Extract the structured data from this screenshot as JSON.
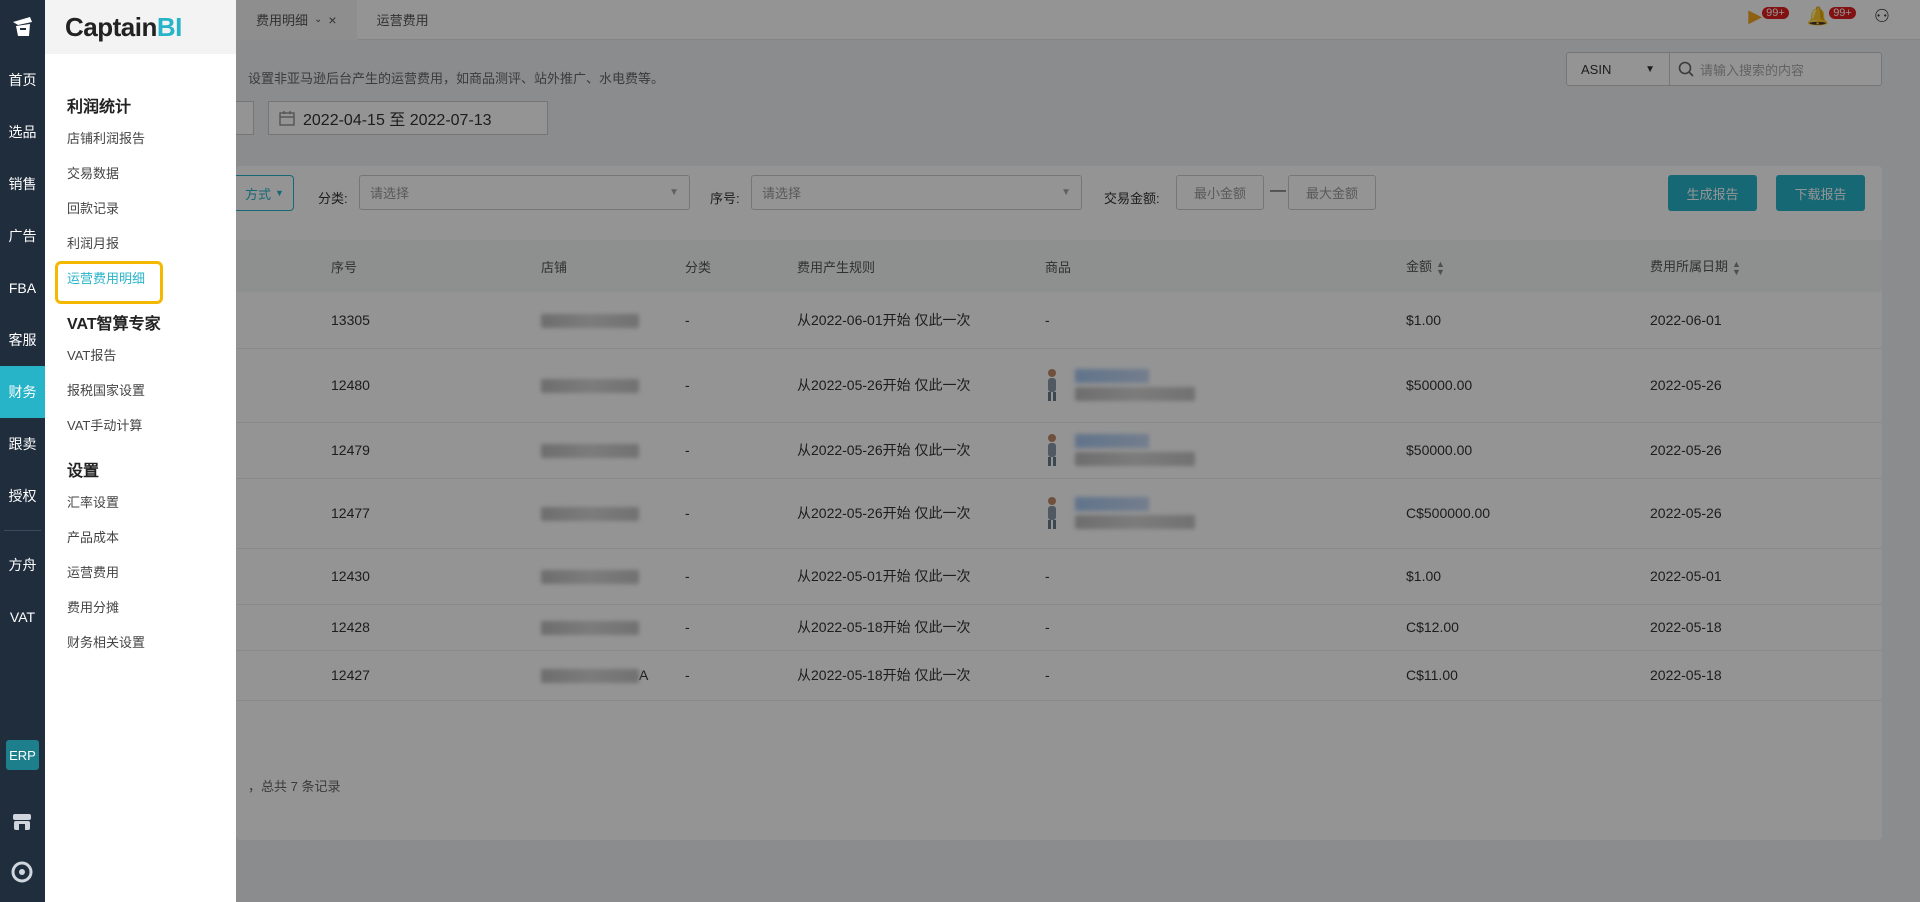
{
  "rail": {
    "items": [
      {
        "label": "首页"
      },
      {
        "label": "选品"
      },
      {
        "label": "销售"
      },
      {
        "label": "广告"
      },
      {
        "label": "FBA"
      },
      {
        "label": "客服"
      },
      {
        "label": "财务",
        "active": true
      },
      {
        "label": "跟卖"
      },
      {
        "label": "授权"
      },
      {
        "label": "方舟"
      },
      {
        "label": "VAT"
      }
    ],
    "erp_label": "ERP"
  },
  "submenu": {
    "brand_part1": "Captain",
    "brand_part2": "BI",
    "groups": [
      {
        "title": "利润统计",
        "items": [
          "店铺利润报告",
          "交易数据",
          "回款记录",
          "利润月报",
          "运营费用明细"
        ]
      },
      {
        "title": "VAT智算专家",
        "items": [
          "VAT报告",
          "报税国家设置",
          "VAT手动计算"
        ]
      },
      {
        "title": "设置",
        "items": [
          "汇率设置",
          "产品成本",
          "运营费用",
          "费用分摊",
          "财务相关设置"
        ]
      }
    ],
    "active_item": "运营费用明细"
  },
  "tabs": [
    {
      "label": "费用明细"
    },
    {
      "label": "运营费用"
    }
  ],
  "badges": {
    "video": "99+",
    "bell": "99+"
  },
  "hint_text": "设置非亚马逊后台产生的运营费用，如商品测评、站外推广、水电费等。",
  "search": {
    "type_label": "ASIN",
    "placeholder": "请输入搜索的内容"
  },
  "date_range": "2022-04-15 至 2022-07-13",
  "filters": {
    "mode_stub": "方式",
    "category_label": "分类:",
    "category_placeholder": "请选择",
    "serial_label": "序号:",
    "serial_placeholder": "请选择",
    "amount_label": "交易金额:",
    "min_placeholder": "最小金额",
    "max_placeholder": "最大金额",
    "dash": "—",
    "generate_button": "生成报告",
    "download_button": "下载报告"
  },
  "table": {
    "headers": {
      "serial": "序号",
      "store": "店铺",
      "category": "分类",
      "rule": "费用产生规则",
      "product": "商品",
      "amount": "金额",
      "date": "费用所属日期"
    },
    "rows": [
      {
        "serial": "13305",
        "category": "-",
        "rule": "从2022-06-01开始 仅此一次",
        "product": "-",
        "has_product": false,
        "amount": "$1.00",
        "date": "2022-06-01",
        "store_suffix": ""
      },
      {
        "serial": "12480",
        "category": "-",
        "rule": "从2022-05-26开始 仅此一次",
        "product": "",
        "has_product": true,
        "amount": "$50000.00",
        "date": "2022-05-26",
        "store_suffix": ""
      },
      {
        "serial": "12479",
        "category": "-",
        "rule": "从2022-05-26开始 仅此一次",
        "product": "",
        "has_product": true,
        "amount": "$50000.00",
        "date": "2022-05-26",
        "store_suffix": ""
      },
      {
        "serial": "12477",
        "category": "-",
        "rule": "从2022-05-26开始 仅此一次",
        "product": "",
        "has_product": true,
        "amount": "C$500000.00",
        "date": "2022-05-26",
        "store_suffix": ""
      },
      {
        "serial": "12430",
        "category": "-",
        "rule": "从2022-05-01开始 仅此一次",
        "product": "-",
        "has_product": false,
        "amount": "$1.00",
        "date": "2022-05-01",
        "store_suffix": ""
      },
      {
        "serial": "12428",
        "category": "-",
        "rule": "从2022-05-18开始 仅此一次",
        "product": "-",
        "has_product": false,
        "amount": "C$12.00",
        "date": "2022-05-18",
        "store_suffix": ""
      },
      {
        "serial": "12427",
        "category": "-",
        "rule": "从2022-05-18开始 仅此一次",
        "product": "-",
        "has_product": false,
        "amount": "C$11.00",
        "date": "2022-05-18",
        "store_suffix": "A"
      }
    ]
  },
  "total_text": "，总共 7 条记录",
  "colors": {
    "accent": "#27b4c9",
    "rail": "#1f2d3d",
    "highlight": "#f5b800"
  }
}
